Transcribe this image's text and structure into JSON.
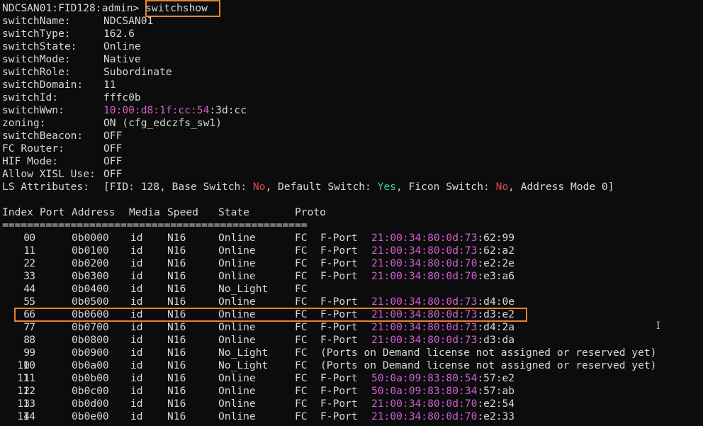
{
  "prompt": "NDCSAN01:FID128:admin>",
  "command": "switchshow",
  "info": [
    {
      "key": "switchName:",
      "value": "NDCSAN01"
    },
    {
      "key": "switchType:",
      "value": "162.6"
    },
    {
      "key": "switchState:",
      "value": "Online"
    },
    {
      "key": "switchMode:",
      "value": "Native"
    },
    {
      "key": "switchRole:",
      "value": "Subordinate"
    },
    {
      "key": "switchDomain:",
      "value": "11"
    },
    {
      "key": "switchId:",
      "value": "fffc0b"
    },
    {
      "key": "switchWwn:",
      "value_pink": "10:00:d8:1f:cc:54",
      "value_rest": ":3d:cc"
    },
    {
      "key": "zoning:",
      "value": "ON (cfg_edczfs_sw1)"
    },
    {
      "key": "switchBeacon:",
      "value": "OFF"
    },
    {
      "key": "FC Router:",
      "value": "OFF"
    },
    {
      "key": "HIF Mode:",
      "value": "OFF"
    },
    {
      "key": "Allow XISL Use:",
      "value": "OFF"
    }
  ],
  "ls_attributes": {
    "key": "LS Attributes:",
    "p1": "[FID: 128, Base Switch: ",
    "v1": "No",
    "p2": ", Default Switch: ",
    "v2": "Yes",
    "p3": ", Ficon Switch: ",
    "v3": "No",
    "p4": ", Address Mode 0]"
  },
  "table": {
    "headers": {
      "index": "Index",
      "port": "Port",
      "address": "Address",
      "media": "Media",
      "speed": "Speed",
      "state": "State",
      "proto": "Proto"
    },
    "rule": "=================================================",
    "rows": [
      {
        "index": "0",
        "port": "0",
        "address": "0b0000",
        "media": "id",
        "speed": "N16",
        "state": "Online",
        "proto": "FC",
        "ptype": "F-Port",
        "wwn_pink": "21:00:34:80:0d:73",
        "wwn_rest": ":62:99",
        "note": ""
      },
      {
        "index": "1",
        "port": "1",
        "address": "0b0100",
        "media": "id",
        "speed": "N16",
        "state": "Online",
        "proto": "FC",
        "ptype": "F-Port",
        "wwn_pink": "21:00:34:80:0d:73",
        "wwn_rest": ":62:a2",
        "note": ""
      },
      {
        "index": "2",
        "port": "2",
        "address": "0b0200",
        "media": "id",
        "speed": "N16",
        "state": "Online",
        "proto": "FC",
        "ptype": "F-Port",
        "wwn_pink": "21:00:34:80:0d:70",
        "wwn_rest": ":e2:2e",
        "note": ""
      },
      {
        "index": "3",
        "port": "3",
        "address": "0b0300",
        "media": "id",
        "speed": "N16",
        "state": "Online",
        "proto": "FC",
        "ptype": "F-Port",
        "wwn_pink": "21:00:34:80:0d:70",
        "wwn_rest": ":e3:a6",
        "note": ""
      },
      {
        "index": "4",
        "port": "4",
        "address": "0b0400",
        "media": "id",
        "speed": "N16",
        "state": "No_Light",
        "proto": "FC",
        "ptype": "",
        "wwn_pink": "",
        "wwn_rest": "",
        "note": ""
      },
      {
        "index": "5",
        "port": "5",
        "address": "0b0500",
        "media": "id",
        "speed": "N16",
        "state": "Online",
        "proto": "FC",
        "ptype": "F-Port",
        "wwn_pink": "21:00:34:80:0d:73",
        "wwn_rest": ":d4:0e",
        "note": ""
      },
      {
        "index": "6",
        "port": "6",
        "address": "0b0600",
        "media": "id",
        "speed": "N16",
        "state": "Online",
        "proto": "FC",
        "ptype": "F-Port",
        "wwn_pink": "21:00:34:80:0d:73",
        "wwn_rest": ":d3:e2",
        "note": ""
      },
      {
        "index": "7",
        "port": "7",
        "address": "0b0700",
        "media": "id",
        "speed": "N16",
        "state": "Online",
        "proto": "FC",
        "ptype": "F-Port",
        "wwn_pink": "21:00:34:80:0d:73",
        "wwn_rest": ":d4:2a",
        "note": ""
      },
      {
        "index": "8",
        "port": "8",
        "address": "0b0800",
        "media": "id",
        "speed": "N16",
        "state": "Online",
        "proto": "FC",
        "ptype": "F-Port",
        "wwn_pink": "21:00:34:80:0d:73",
        "wwn_rest": ":d3:da",
        "note": ""
      },
      {
        "index": "9",
        "port": "9",
        "address": "0b0900",
        "media": "id",
        "speed": "N16",
        "state": "No_Light",
        "proto": "FC",
        "ptype": "",
        "wwn_pink": "",
        "wwn_rest": "",
        "note": "(Ports on Demand license not assigned or reserved yet)"
      },
      {
        "index": "10",
        "port": "10",
        "address": "0b0a00",
        "media": "id",
        "speed": "N16",
        "state": "No_Light",
        "proto": "FC",
        "ptype": "",
        "wwn_pink": "",
        "wwn_rest": "",
        "note": "(Ports on Demand license not assigned or reserved yet)"
      },
      {
        "index": "11",
        "port": "11",
        "address": "0b0b00",
        "media": "id",
        "speed": "N16",
        "state": "Online",
        "proto": "FC",
        "ptype": "F-Port",
        "wwn_pink": "50:0a:09:83:80:54",
        "wwn_rest": ":57:e2",
        "note": ""
      },
      {
        "index": "12",
        "port": "12",
        "address": "0b0c00",
        "media": "id",
        "speed": "N16",
        "state": "Online",
        "proto": "FC",
        "ptype": "F-Port",
        "wwn_pink": "50:0a:09:83:80:34",
        "wwn_rest": ":57:ab",
        "note": ""
      },
      {
        "index": "13",
        "port": "13",
        "address": "0b0d00",
        "media": "id",
        "speed": "N16",
        "state": "Online",
        "proto": "FC",
        "ptype": "F-Port",
        "wwn_pink": "21:00:34:80:0d:70",
        "wwn_rest": ":e2:54",
        "note": ""
      },
      {
        "index": "14",
        "port": "14",
        "address": "0b0e00",
        "media": "id",
        "speed": "N16",
        "state": "Online",
        "proto": "FC",
        "ptype": "F-Port",
        "wwn_pink": "21:00:34:80:0d:70",
        "wwn_rest": ":e2:33",
        "note": ""
      }
    ]
  },
  "highlight_color": "#e8822c",
  "wwn_color": "#d35fd3",
  "no_color": "#e04a4a",
  "yes_color": "#2ed39a",
  "cursor_icon": "text-cursor-icon",
  "cursor_glyph": "I"
}
